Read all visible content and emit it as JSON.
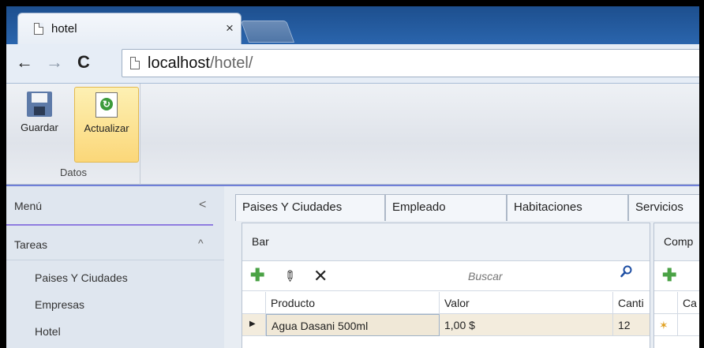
{
  "browser": {
    "tab_title": "hotel",
    "tab_close": "×",
    "back": "←",
    "forward": "→",
    "reload": "C",
    "url_host": "localhost",
    "url_path": "/hotel/"
  },
  "ribbon": {
    "save_label": "Guardar",
    "refresh_label": "Actualizar",
    "group_label": "Datos"
  },
  "sidebar": {
    "menu_title": "Menú",
    "menu_collapse": "<",
    "tasks_title": "Tareas",
    "tasks_toggle": "^",
    "items": [
      {
        "label": "Paises Y Ciudades"
      },
      {
        "label": "Empresas"
      },
      {
        "label": "Hotel"
      }
    ]
  },
  "tabs": [
    {
      "label": "Paises Y Ciudades"
    },
    {
      "label": "Empleado"
    },
    {
      "label": "Habitaciones"
    },
    {
      "label": "Servicios"
    }
  ],
  "bar_panel": {
    "title": "Bar",
    "search_placeholder": "Buscar",
    "columns": [
      "Producto",
      "Valor",
      "Canti"
    ],
    "rows": [
      {
        "producto": "Agua Dasani 500ml",
        "valor": "1,00 $",
        "cantidad": "12"
      }
    ]
  },
  "comp_panel": {
    "title": "Comp",
    "columns": [
      "",
      "Ca"
    ]
  },
  "colors": {
    "accent": "#8f7de0",
    "selection": "#f3ecdd",
    "chrome_blue": "#2a65ad"
  }
}
